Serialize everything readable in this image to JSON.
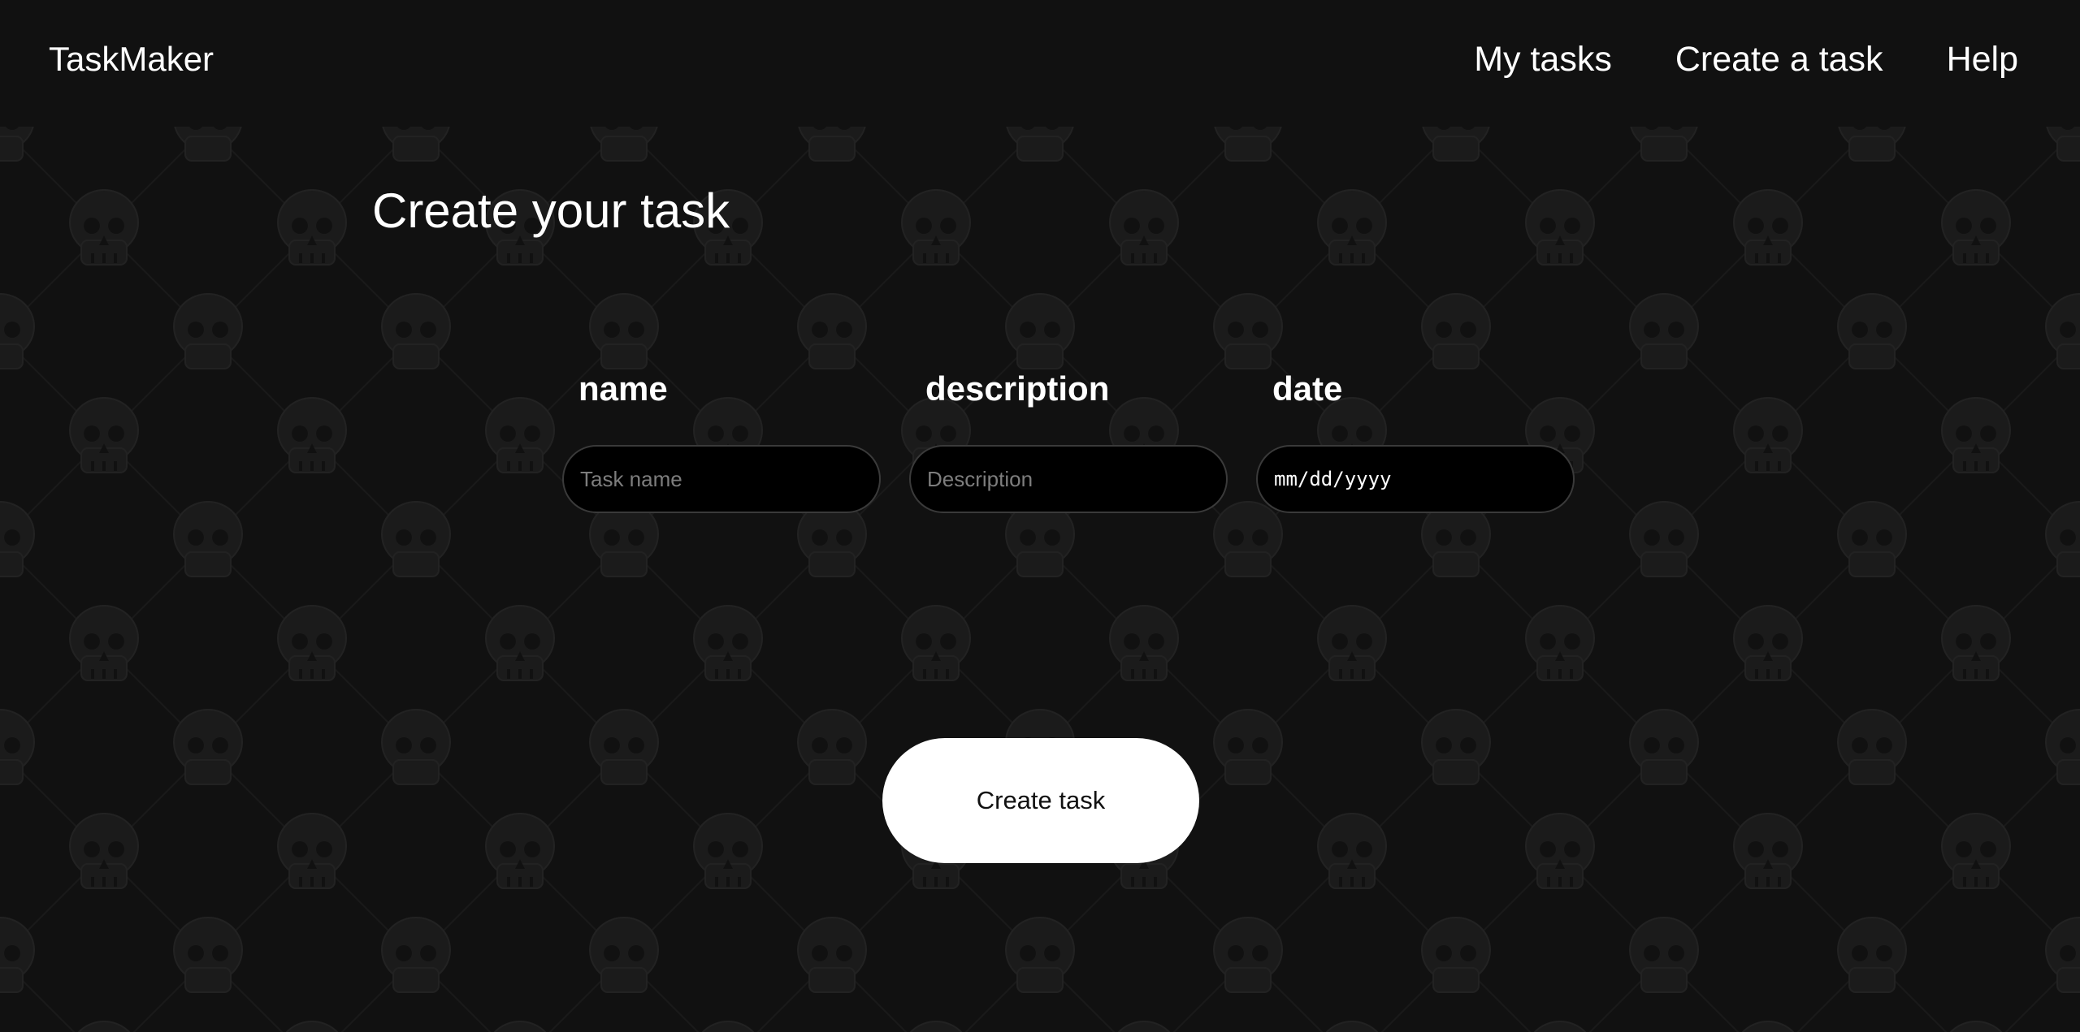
{
  "header": {
    "brand": "TaskMaker",
    "nav": [
      {
        "label": "My tasks"
      },
      {
        "label": "Create a task"
      },
      {
        "label": "Help"
      }
    ]
  },
  "main": {
    "title": "Create your task",
    "fields": [
      {
        "label": "name",
        "placeholder": "Task name",
        "value": ""
      },
      {
        "label": "description",
        "placeholder": "Description",
        "value": ""
      },
      {
        "label": "date",
        "placeholder": "mm/dd/yyyy",
        "value": ""
      }
    ],
    "submit_label": "Create task"
  },
  "colors": {
    "background": "#111111",
    "pattern": "#1c1c1c",
    "input_bg": "#000000",
    "input_border": "#3a3a3a",
    "button_bg": "#ffffff",
    "text": "#ffffff"
  },
  "background_pattern": {
    "icon": "skull-icon"
  }
}
